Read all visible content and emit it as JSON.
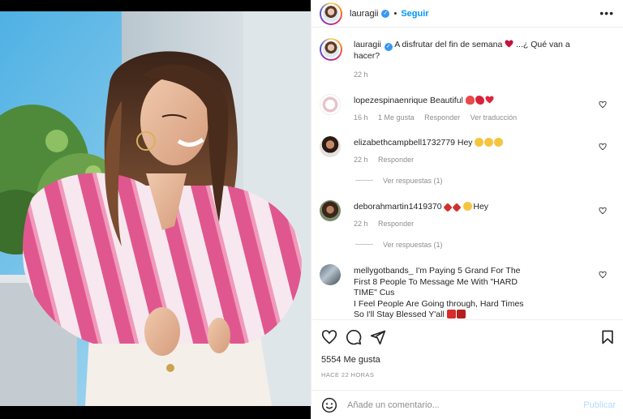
{
  "post": {
    "username": "lauragii",
    "follow_label": "Seguir",
    "more_icon": "more-horizontal-icon"
  },
  "caption": {
    "username": "lauragii",
    "text": "A disfrutar del fin de semana",
    "text_after": " ...¿ Qué van a hacer?",
    "time": "22 h"
  },
  "comments": [
    {
      "username": "lopezespinaenrique",
      "text": "Beautiful",
      "meta": [
        "16 h",
        "1 Me gusta",
        "Responder",
        "Ver traducción"
      ]
    },
    {
      "username": "elizabethcampbell1732779",
      "text": "Hey",
      "meta": [
        "22 h",
        "Responder"
      ],
      "replies": "Ver respuestas (1)"
    },
    {
      "username": "deborahmartin1419370",
      "text": "Hey",
      "meta": [
        "22 h",
        "Responder"
      ],
      "replies": "Ver respuestas (1)"
    },
    {
      "username": "mellygotbands_",
      "text_line1": "I'm Paying 5 Grand For The",
      "text_line2": "First 8 People To Message Me With \"HARD",
      "text_line3": "TIME\" Cus",
      "text_line4": "I Feel People Are Going through, Hard Times",
      "text_line5": "So I'll Stay Blessed Y'all"
    }
  ],
  "actions": {
    "likes": "5554 Me gusta",
    "ago": "HACE 22 HORAS"
  },
  "composer": {
    "placeholder": "Añade un comentario...",
    "publish_label": "Publicar"
  },
  "colors": {
    "link": "#0095f6",
    "muted": "#8e8e8e",
    "publish_disabled": "#b3dbff"
  }
}
